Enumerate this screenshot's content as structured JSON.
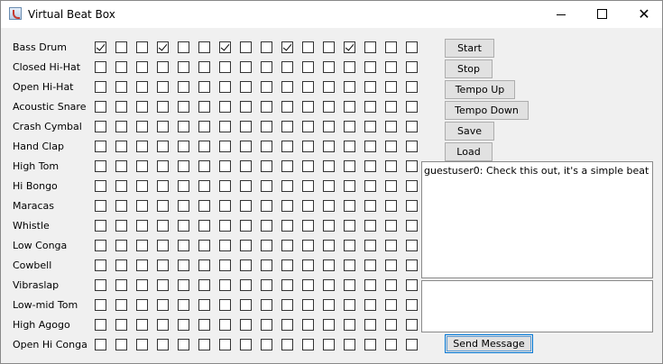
{
  "window": {
    "title": "Virtual Beat Box",
    "icon": "java-cup-icon"
  },
  "instruments": [
    {
      "name": "Bass Drum",
      "beats": [
        true,
        false,
        false,
        true,
        false,
        false,
        true,
        false,
        false,
        true,
        false,
        false,
        true,
        false,
        false,
        false
      ]
    },
    {
      "name": "Closed Hi-Hat",
      "beats": [
        false,
        false,
        false,
        false,
        false,
        false,
        false,
        false,
        false,
        false,
        false,
        false,
        false,
        false,
        false,
        false
      ]
    },
    {
      "name": "Open Hi-Hat",
      "beats": [
        false,
        false,
        false,
        false,
        false,
        false,
        false,
        false,
        false,
        false,
        false,
        false,
        false,
        false,
        false,
        false
      ]
    },
    {
      "name": "Acoustic Snare",
      "beats": [
        false,
        false,
        false,
        false,
        false,
        false,
        false,
        false,
        false,
        false,
        false,
        false,
        false,
        false,
        false,
        false
      ]
    },
    {
      "name": "Crash Cymbal",
      "beats": [
        false,
        false,
        false,
        false,
        false,
        false,
        false,
        false,
        false,
        false,
        false,
        false,
        false,
        false,
        false,
        false
      ]
    },
    {
      "name": "Hand Clap",
      "beats": [
        false,
        false,
        false,
        false,
        false,
        false,
        false,
        false,
        false,
        false,
        false,
        false,
        false,
        false,
        false,
        false
      ]
    },
    {
      "name": "High Tom",
      "beats": [
        false,
        false,
        false,
        false,
        false,
        false,
        false,
        false,
        false,
        false,
        false,
        false,
        false,
        false,
        false,
        false
      ]
    },
    {
      "name": "Hi Bongo",
      "beats": [
        false,
        false,
        false,
        false,
        false,
        false,
        false,
        false,
        false,
        false,
        false,
        false,
        false,
        false,
        false,
        false
      ]
    },
    {
      "name": "Maracas",
      "beats": [
        false,
        false,
        false,
        false,
        false,
        false,
        false,
        false,
        false,
        false,
        false,
        false,
        false,
        false,
        false,
        false
      ]
    },
    {
      "name": "Whistle",
      "beats": [
        false,
        false,
        false,
        false,
        false,
        false,
        false,
        false,
        false,
        false,
        false,
        false,
        false,
        false,
        false,
        false
      ]
    },
    {
      "name": "Low Conga",
      "beats": [
        false,
        false,
        false,
        false,
        false,
        false,
        false,
        false,
        false,
        false,
        false,
        false,
        false,
        false,
        false,
        false
      ]
    },
    {
      "name": "Cowbell",
      "beats": [
        false,
        false,
        false,
        false,
        false,
        false,
        false,
        false,
        false,
        false,
        false,
        false,
        false,
        false,
        false,
        false
      ]
    },
    {
      "name": "Vibraslap",
      "beats": [
        false,
        false,
        false,
        false,
        false,
        false,
        false,
        false,
        false,
        false,
        false,
        false,
        false,
        false,
        false,
        false
      ]
    },
    {
      "name": "Low-mid Tom",
      "beats": [
        false,
        false,
        false,
        false,
        false,
        false,
        false,
        false,
        false,
        false,
        false,
        false,
        false,
        false,
        false,
        false
      ]
    },
    {
      "name": "High Agogo",
      "beats": [
        false,
        false,
        false,
        false,
        false,
        false,
        false,
        false,
        false,
        false,
        false,
        false,
        false,
        false,
        false,
        false
      ]
    },
    {
      "name": "Open Hi Conga",
      "beats": [
        false,
        false,
        false,
        false,
        false,
        false,
        false,
        false,
        false,
        false,
        false,
        false,
        false,
        false,
        false,
        false
      ]
    }
  ],
  "controls": {
    "start": "Start",
    "stop": "Stop",
    "tempo_up": "Tempo Up",
    "tempo_down": "Tempo Down",
    "save": "Save",
    "load": "Load"
  },
  "chat": {
    "messages": [
      "guestuser0: Check this out, it's a simple beat"
    ],
    "input_value": "",
    "send_label": "Send Message"
  }
}
